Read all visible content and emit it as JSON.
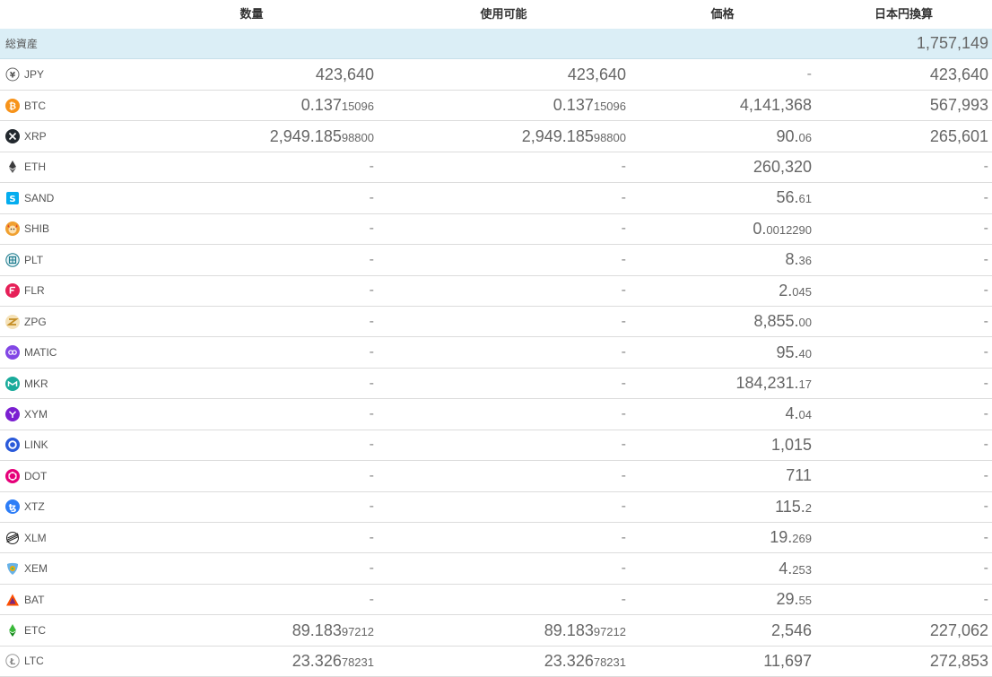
{
  "headers": {
    "quantity": "数量",
    "available": "使用可能",
    "price": "価格",
    "jpy_value": "日本円換算"
  },
  "total": {
    "label": "総資産",
    "jpy_value": "1,757,149"
  },
  "rows": [
    {
      "symbol": "JPY",
      "icon": "yen-icon",
      "color": "#ffffff",
      "qty": [
        "423,640",
        ""
      ],
      "avail": [
        "423,640",
        ""
      ],
      "price": [
        "-",
        ""
      ],
      "value": "423,640"
    },
    {
      "symbol": "BTC",
      "icon": "bitcoin-icon",
      "color": "#f7931a",
      "qty": [
        "0.137",
        "15096"
      ],
      "avail": [
        "0.137",
        "15096"
      ],
      "price": [
        "4,141,368",
        ""
      ],
      "value": "567,993"
    },
    {
      "symbol": "XRP",
      "icon": "xrp-icon",
      "color": "#23292f",
      "qty": [
        "2,949.185",
        "98800"
      ],
      "avail": [
        "2,949.185",
        "98800"
      ],
      "price": [
        "90.",
        "06"
      ],
      "value": "265,601"
    },
    {
      "symbol": "ETH",
      "icon": "ethereum-icon",
      "color": "#3c3c3d",
      "qty": [
        "-",
        ""
      ],
      "avail": [
        "-",
        ""
      ],
      "price": [
        "260,320",
        ""
      ],
      "value": "-"
    },
    {
      "symbol": "SAND",
      "icon": "sand-icon",
      "color": "#04adef",
      "qty": [
        "-",
        ""
      ],
      "avail": [
        "-",
        ""
      ],
      "price": [
        "56.",
        "61"
      ],
      "value": "-"
    },
    {
      "symbol": "SHIB",
      "icon": "shib-icon",
      "color": "#f0a030",
      "qty": [
        "-",
        ""
      ],
      "avail": [
        "-",
        ""
      ],
      "price": [
        "0.",
        "0012290"
      ],
      "value": "-"
    },
    {
      "symbol": "PLT",
      "icon": "plt-icon",
      "color": "#1b7a8c",
      "qty": [
        "-",
        ""
      ],
      "avail": [
        "-",
        ""
      ],
      "price": [
        "8.",
        "36"
      ],
      "value": "-"
    },
    {
      "symbol": "FLR",
      "icon": "flare-icon",
      "color": "#e62058",
      "qty": [
        "-",
        ""
      ],
      "avail": [
        "-",
        ""
      ],
      "price": [
        "2.",
        "045"
      ],
      "value": "-"
    },
    {
      "symbol": "ZPG",
      "icon": "zpg-icon",
      "color": "#d9a53a",
      "qty": [
        "-",
        ""
      ],
      "avail": [
        "-",
        ""
      ],
      "price": [
        "8,855.",
        "00"
      ],
      "value": "-"
    },
    {
      "symbol": "MATIC",
      "icon": "polygon-icon",
      "color": "#8247e5",
      "qty": [
        "-",
        ""
      ],
      "avail": [
        "-",
        ""
      ],
      "price": [
        "95.",
        "40"
      ],
      "value": "-"
    },
    {
      "symbol": "MKR",
      "icon": "maker-icon",
      "color": "#1aab9b",
      "qty": [
        "-",
        ""
      ],
      "avail": [
        "-",
        ""
      ],
      "price": [
        "184,231.",
        "17"
      ],
      "value": "-"
    },
    {
      "symbol": "XYM",
      "icon": "symbol-icon",
      "color": "#7b1fd1",
      "qty": [
        "-",
        ""
      ],
      "avail": [
        "-",
        ""
      ],
      "price": [
        "4.",
        "04"
      ],
      "value": "-"
    },
    {
      "symbol": "LINK",
      "icon": "chainlink-icon",
      "color": "#2a5ada",
      "qty": [
        "-",
        ""
      ],
      "avail": [
        "-",
        ""
      ],
      "price": [
        "1,015",
        ""
      ],
      "value": "-"
    },
    {
      "symbol": "DOT",
      "icon": "polkadot-icon",
      "color": "#e6007a",
      "qty": [
        "-",
        ""
      ],
      "avail": [
        "-",
        ""
      ],
      "price": [
        "711",
        ""
      ],
      "value": "-"
    },
    {
      "symbol": "XTZ",
      "icon": "tezos-icon",
      "color": "#2c7df7",
      "qty": [
        "-",
        ""
      ],
      "avail": [
        "-",
        ""
      ],
      "price": [
        "115.",
        "2"
      ],
      "value": "-"
    },
    {
      "symbol": "XLM",
      "icon": "stellar-icon",
      "color": "#222222",
      "qty": [
        "-",
        ""
      ],
      "avail": [
        "-",
        ""
      ],
      "price": [
        "19.",
        "269"
      ],
      "value": "-"
    },
    {
      "symbol": "XEM",
      "icon": "nem-icon",
      "color": "#67b2e8",
      "qty": [
        "-",
        ""
      ],
      "avail": [
        "-",
        ""
      ],
      "price": [
        "4.",
        "253"
      ],
      "value": "-"
    },
    {
      "symbol": "BAT",
      "icon": "bat-icon",
      "color": "#ff5000",
      "qty": [
        "-",
        ""
      ],
      "avail": [
        "-",
        ""
      ],
      "price": [
        "29.",
        "55"
      ],
      "value": "-"
    },
    {
      "symbol": "ETC",
      "icon": "ethereum-classic-icon",
      "color": "#3ab83a",
      "qty": [
        "89.183",
        "97212"
      ],
      "avail": [
        "89.183",
        "97212"
      ],
      "price": [
        "2,546",
        ""
      ],
      "value": "227,062"
    },
    {
      "symbol": "LTC",
      "icon": "litecoin-icon",
      "color": "#bfbbbb",
      "qty": [
        "23.326",
        "78231"
      ],
      "avail": [
        "23.326",
        "78231"
      ],
      "price": [
        "11,697",
        ""
      ],
      "value": "272,853"
    }
  ]
}
